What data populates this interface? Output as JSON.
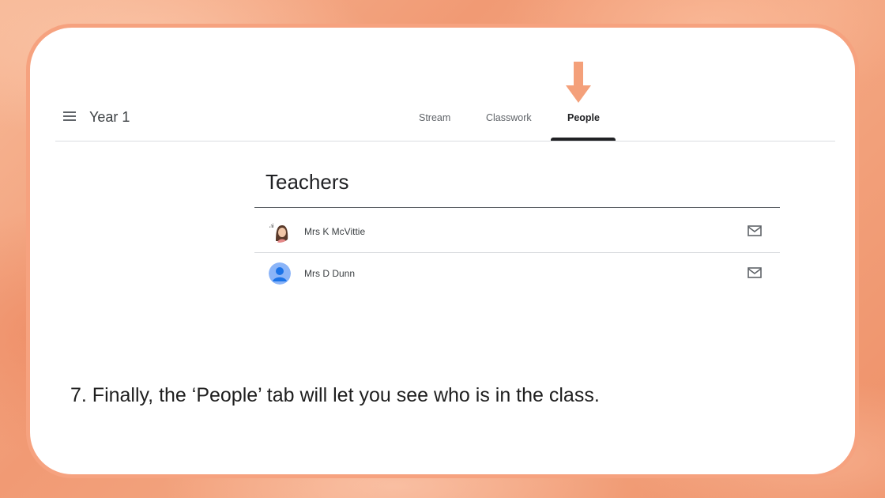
{
  "header": {
    "class_name": "Year 1",
    "tabs": [
      {
        "label": "Stream",
        "active": false
      },
      {
        "label": "Classwork",
        "active": false
      },
      {
        "label": "People",
        "active": true
      }
    ]
  },
  "teachers": {
    "heading": "Teachers",
    "items": [
      {
        "name": "Mrs K McVittie",
        "avatar": "bitmoji-avatar"
      },
      {
        "name": "Mrs D Dunn",
        "avatar": "default-person-avatar"
      }
    ]
  },
  "caption": "7. Finally, the ‘People’ tab will let you see who is in the class.",
  "colors": {
    "accent_arrow": "#f4a07a",
    "background": "#f2a07c",
    "default_avatar": "#8ab4f8"
  },
  "icons": [
    "hamburger-menu-icon",
    "mail-icon",
    "down-arrow-icon"
  ]
}
